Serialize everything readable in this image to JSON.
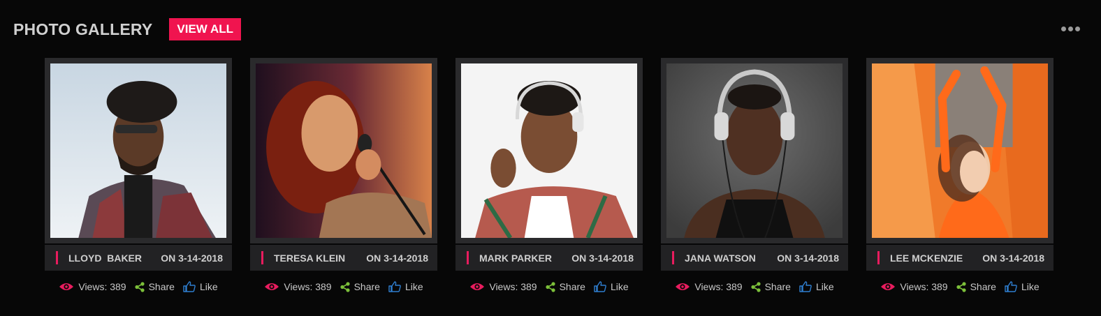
{
  "header": {
    "title": "PHOTO GALLERY",
    "view_all": "VIEW ALL"
  },
  "colors": {
    "accent": "#f0144f",
    "eye": "#e81c5e",
    "share": "#7cc03a",
    "like": "#2f7fd0"
  },
  "icons": {
    "more": "more-dots-icon",
    "views": "eye-icon",
    "share": "share-icon",
    "like": "thumbs-up-icon"
  },
  "cards": [
    {
      "name": "LLOYD  BAKER",
      "date": "ON 3-14-2018",
      "views": "Views: 389",
      "share": "Share",
      "like": "Like"
    },
    {
      "name": "TERESA KLEIN",
      "date": "ON 3-14-2018",
      "views": "Views: 389",
      "share": "Share",
      "like": "Like"
    },
    {
      "name": "MARK PARKER",
      "date": "ON 3-14-2018",
      "views": "Views: 389",
      "share": "Share",
      "like": "Like"
    },
    {
      "name": "JANA WATSON",
      "date": "ON 3-14-2018",
      "views": "Views: 389",
      "share": "Share",
      "like": "Like"
    },
    {
      "name": "LEE MCKENZIE",
      "date": "ON 3-14-2018",
      "views": "Views: 389",
      "share": "Share",
      "like": "Like"
    }
  ]
}
